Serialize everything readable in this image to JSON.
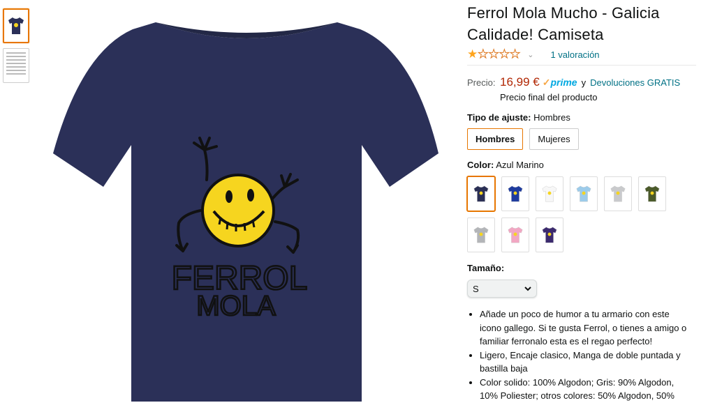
{
  "product": {
    "title": "Ferrol Mola Mucho - Galicia Calidade! Camiseta",
    "rating_stars": 1,
    "rating_count_text": "1 valoración",
    "price_label": "Precio:",
    "price": "16,99 €",
    "prime_label": "prime",
    "and_text": "y",
    "returns_link": "Devoluciones GRATIS",
    "final_price_text": "Precio final del producto",
    "print_line1": "FERROL",
    "print_line2": "MOLA"
  },
  "fit": {
    "label": "Tipo de ajuste:",
    "selected": "Hombres",
    "options": [
      "Hombres",
      "Mujeres"
    ]
  },
  "color": {
    "label": "Color:",
    "selected": "Azul Marino",
    "swatches": [
      {
        "name": "swatch-azul-marino",
        "color": "#2A2F55"
      },
      {
        "name": "swatch-azul-real",
        "color": "#1F3C9E"
      },
      {
        "name": "swatch-blanco",
        "color": "#F7F7F7"
      },
      {
        "name": "swatch-azul-claro",
        "color": "#9CCBEA"
      },
      {
        "name": "swatch-gris-claro",
        "color": "#C9CACC"
      },
      {
        "name": "swatch-verde-oliva",
        "color": "#4B5A2A"
      },
      {
        "name": "swatch-gris",
        "color": "#B3B5B8"
      },
      {
        "name": "swatch-rosa",
        "color": "#F2A7C3"
      },
      {
        "name": "swatch-morado",
        "color": "#3B2A6E"
      }
    ]
  },
  "size": {
    "label": "Tamaño:",
    "selected": "S"
  },
  "bullets": [
    "Añade un poco de humor a tu armario con este icono gallego. Si te gusta Ferrol, o tienes a amigo o familiar ferronalo esta es el regao perfecto!",
    "Ligero, Encaje clasico, Manga de doble puntada y bastilla baja",
    "Color solido: 100% Algodon; Gris: 90% Algodon, 10% Poliester; otros colores: 50% Algodon, 50%"
  ],
  "colors": {
    "shirt": "#2B3058",
    "accent": "#E77600",
    "link": "#007185",
    "price": "#B12704"
  }
}
